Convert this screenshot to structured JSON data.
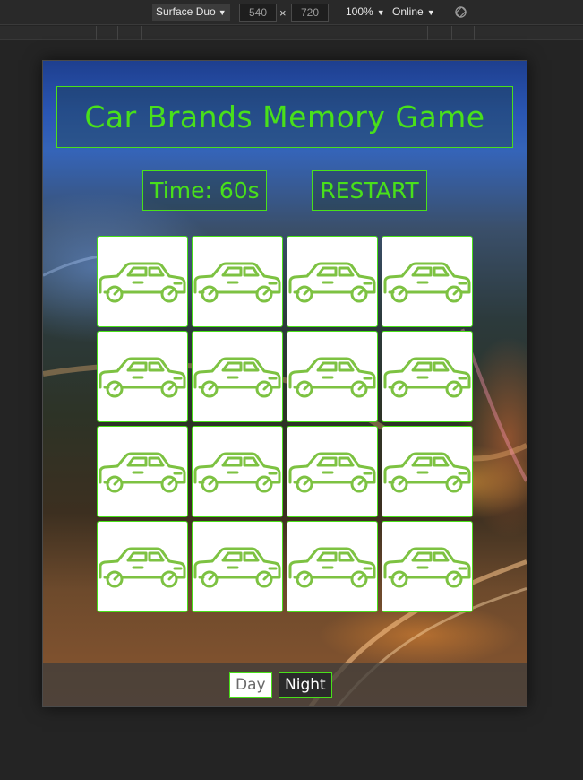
{
  "devtools": {
    "device": "Surface Duo",
    "width": "540",
    "height": "720",
    "times": "×",
    "zoom": "100%",
    "network": "Online"
  },
  "game": {
    "title": "Car Brands Memory Game",
    "timer": "Time: 60s",
    "restart": "RESTART",
    "card_icon": "car-icon",
    "card_count": 16
  },
  "footer": {
    "day": "Day",
    "night": "Night"
  },
  "colors": {
    "accent": "#49e01a",
    "car_stroke": "#7dc242"
  }
}
